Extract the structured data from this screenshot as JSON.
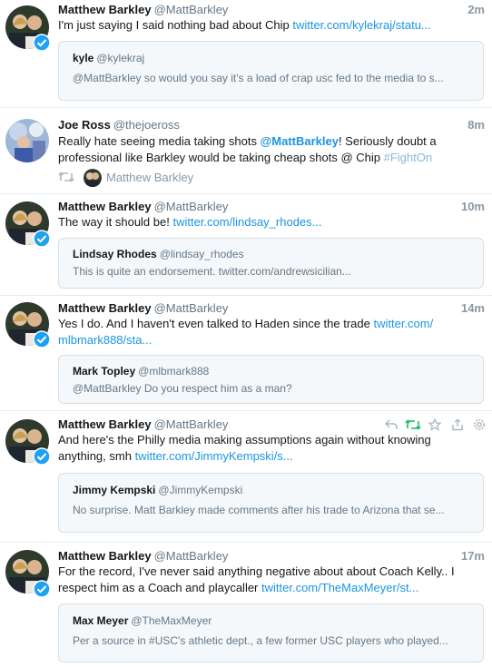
{
  "colors": {
    "link": "#1b95e0",
    "retweet_green": "#17bf63",
    "muted": "#657786",
    "verified": "#1da1f2",
    "border": "#e6ecf0",
    "quote_bg": "#f5f8fa"
  },
  "icons": {
    "reply": "reply-icon",
    "retweet": "retweet-icon",
    "like": "star-icon",
    "share": "share-icon",
    "more": "gear-icon",
    "verified": "verified-badge-icon"
  },
  "tweets": [
    {
      "name": "Matthew Barkley",
      "handle": "@MattBarkley",
      "time": "2m",
      "text": "I'm just saying I said nothing bad about Chip",
      "link": "twitter.com/kylekraj/statu...",
      "quote": {
        "name": "kyle",
        "handle": "@kylekraj",
        "text": "@MattBarkley so would you say it's a load of crap usc fed to the media to s..."
      }
    },
    {
      "name": "Joe Ross",
      "handle": "@thejoeross",
      "time": "8m",
      "text_before": "Really hate seeing media taking shots ",
      "mention": "@MattBarkley",
      "text_after": "! Seriously doubt a professional like Barkley would be taking cheap shots @ Chip ",
      "hashtag": "#FightOn",
      "retweeted_by": "Matthew Barkley"
    },
    {
      "name": "Matthew Barkley",
      "handle": "@MattBarkley",
      "time": "10m",
      "text": "The way it should be!",
      "link": "twitter.com/lindsay_rhodes...",
      "quote": {
        "name": "Lindsay Rhodes",
        "handle": "@lindsay_rhodes",
        "text": "This is quite an endorsement. twitter.com/andrewsicilian..."
      }
    },
    {
      "name": "Matthew Barkley",
      "handle": "@MattBarkley",
      "time": "14m",
      "text": "Yes I do. And I haven't even talked to Haden since the trade",
      "link": "twitter.com/ mlbmark888/sta...",
      "quote": {
        "name": "Mark Topley",
        "handle": "@mlbmark888",
        "text": "@MattBarkley Do you respect him as a man?"
      }
    },
    {
      "name": "Matthew Barkley",
      "handle": "@MattBarkley",
      "time": "",
      "text": "And here's the Philly media making assumptions again without knowing anything, smh",
      "link": "twitter.com/JimmyKempski/s...",
      "quote": {
        "name": "Jimmy Kempski",
        "handle": "@JimmyKempski",
        "text": "No surprise. Matt Barkley made comments after his trade to Arizona that se..."
      }
    },
    {
      "name": "Matthew Barkley",
      "handle": "@MattBarkley",
      "time": "17m",
      "text": "For the record, I've never said anything negative about about Coach Kelly.. I respect him as a Coach and playcaller",
      "link": "twitter.com/TheMaxMeyer/st...",
      "quote": {
        "name": "Max Meyer",
        "handle": "@TheMaxMeyer",
        "text": "Per a source in #USC's athletic dept., a few former USC players who played..."
      }
    }
  ]
}
